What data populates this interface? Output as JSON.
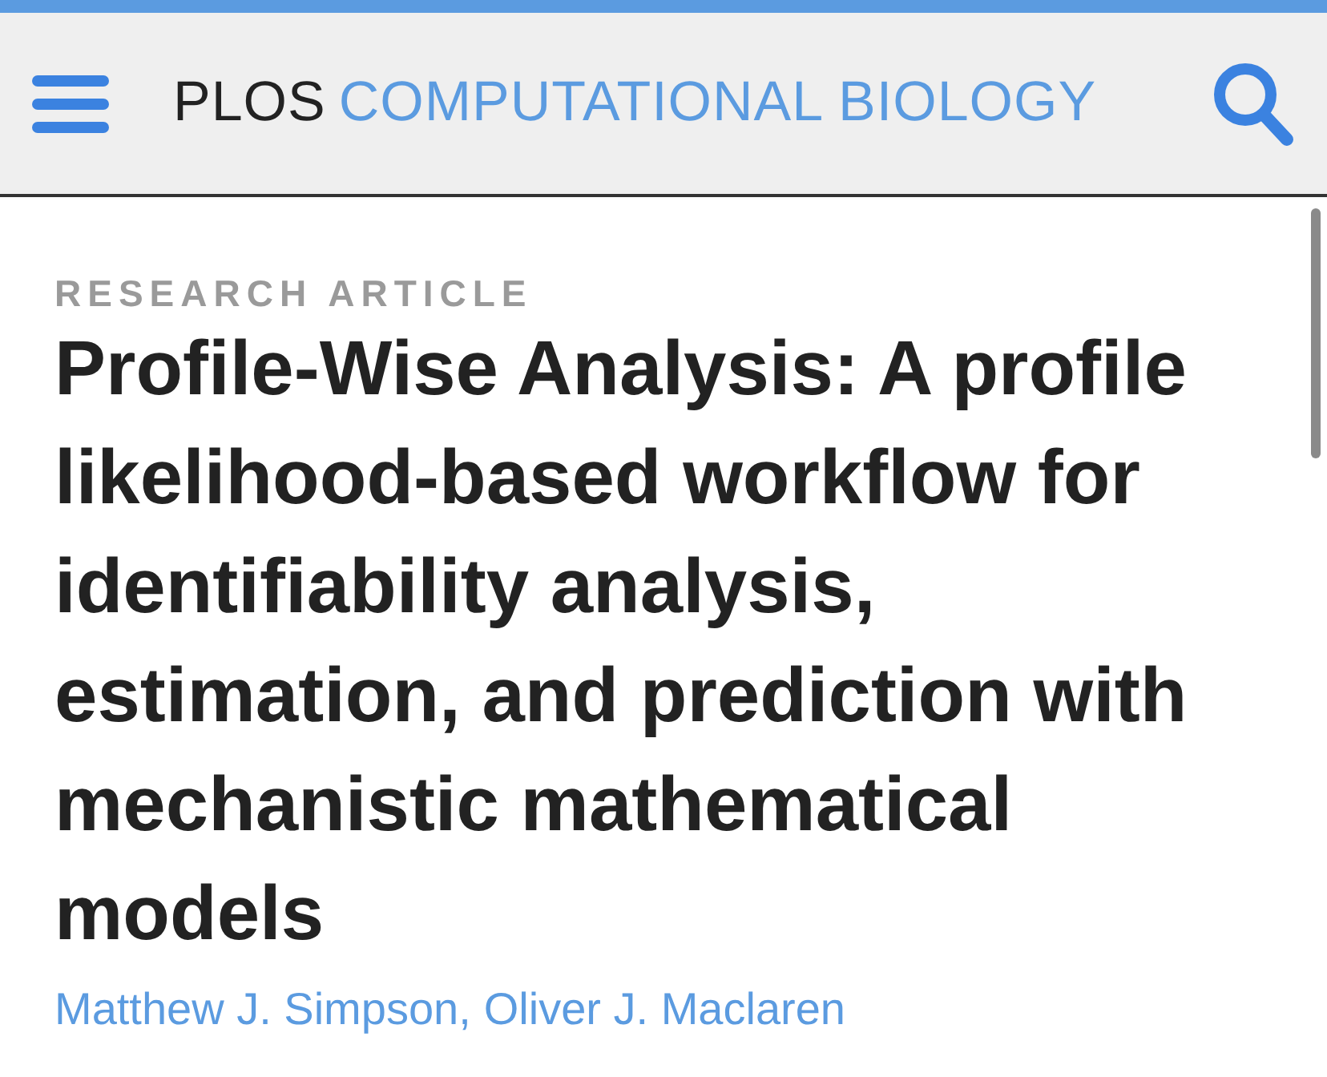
{
  "header": {
    "logo": {
      "prefix": "PLOS",
      "name": "COMPUTATIONAL BIOLOGY"
    }
  },
  "article": {
    "type": "RESEARCH ARTICLE",
    "title": "Profile-Wise Analysis: A profile likelihood-based workflow for identifiability analysis, estimation, and prediction with mechanistic mathematical models",
    "authors": [
      "Matthew J. Simpson,",
      "Oliver J. Maclaren"
    ]
  }
}
